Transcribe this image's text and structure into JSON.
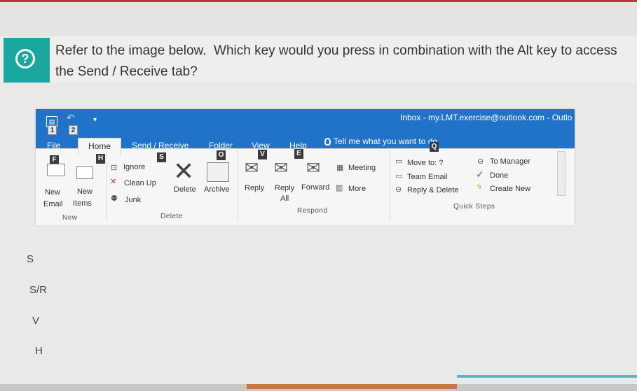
{
  "question": {
    "text": "Refer to the image below.  Which key would you press in combination with the Alt key to access the Send / Receive tab?",
    "icon": "help-icon"
  },
  "outlook": {
    "title": "Inbox - my.LMT.exercise@outlook.com - Outlo",
    "qat_keytips": [
      "1",
      "2"
    ],
    "tabs": [
      {
        "label": "File",
        "keytip": "F"
      },
      {
        "label": "Home",
        "keytip": "H"
      },
      {
        "label": "Send / Receive",
        "keytip": "S"
      },
      {
        "label": "Folder",
        "keytip": "O"
      },
      {
        "label": "View",
        "keytip": "V"
      },
      {
        "label": "Help",
        "keytip": "E"
      }
    ],
    "tell_me": {
      "text": "Tell me what you want to do",
      "keytip": "Q"
    },
    "ribbon": {
      "new_email": [
        "New",
        "Email"
      ],
      "new_items": [
        "New",
        "Items"
      ],
      "ignore": "Ignore",
      "clean_up": "Clean Up",
      "junk": "Junk",
      "delete": "Delete",
      "archive": "Archive",
      "reply": "Reply",
      "reply_all": [
        "Reply",
        "All"
      ],
      "forward": "Forward",
      "meeting": "Meeting",
      "more": "More",
      "move_to": "Move to: ?",
      "team_email": "Team Email",
      "reply_delete": "Reply & Delete",
      "to_manager": "To Manager",
      "done": "Done",
      "create_new": "Create New"
    },
    "groups": {
      "new": "New",
      "delete": "Delete",
      "respond": "Respond",
      "quick_steps": "Quick Steps"
    }
  },
  "options": [
    "S",
    "S/R",
    "V",
    "H"
  ],
  "colors": {
    "accent": "#1aa7a0",
    "outlook_blue": "#2073c9"
  }
}
